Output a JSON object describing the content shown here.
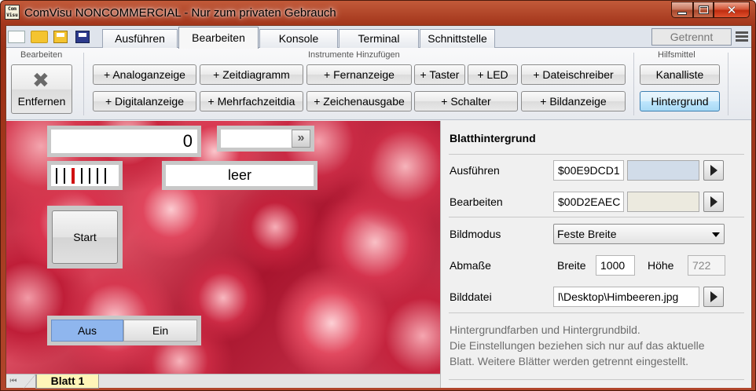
{
  "window": {
    "app_icon_text": "Com Visu",
    "title": "ComVisu NONCOMMERCIAL - Nur zum privaten Gebrauch"
  },
  "tabs": [
    "Ausführen",
    "Bearbeiten",
    "Konsole",
    "Terminal",
    "Schnittstelle"
  ],
  "active_tab": "Bearbeiten",
  "connection_status": "Getrennt",
  "ribbon": {
    "group_edit_label": "Bearbeiten",
    "remove_label": "Entfernen",
    "group_instruments_label": "Instrumente Hinzufügen",
    "instruments": {
      "analog": "+ Analoganzeige",
      "timechart": "+ Zeitdiagramm",
      "remote": "+ Fernanzeige",
      "pushbutton": "+ Taster",
      "led": "+ LED",
      "filewriter": "+ Dateischreiber",
      "digital": "+ Digitalanzeige",
      "multichart": "+ Mehrfachzeitdia",
      "charout": "+ Zeichenausgabe",
      "switch": "+ Schalter",
      "image": "+ Bildanzeige"
    },
    "group_tools_label": "Hilfsmittel",
    "channel_list_label": "Kanalliste",
    "background_label": "Hintergrund"
  },
  "canvas": {
    "numeric_value": "0",
    "text_display": "leer",
    "edit_arrow_glyph": "»",
    "start_label": "Start",
    "switch_off": "Aus",
    "switch_on": "Ein"
  },
  "sheet": {
    "nav_glyph": "⏮",
    "tab_label": "Blatt 1"
  },
  "properties": {
    "title": "Blatthintergrund",
    "run_label": "Ausführen",
    "run_color": "$00E9DCD1",
    "run_swatch": "#d1dce9",
    "edit_label": "Bearbeiten",
    "edit_color": "$00D2EAEC",
    "edit_swatch": "#eceadf",
    "image_mode_label": "Bildmodus",
    "image_mode_value": "Feste Breite",
    "dimensions_label": "Abmaße",
    "width_label": "Breite",
    "width_value": "1000",
    "height_label": "Höhe",
    "height_value": "722",
    "file_label": "Bilddatei",
    "file_value": "l\\Desktop\\Himbeeren.jpg",
    "help_line1": "Hintergrundfarben und Hintergrundbild.",
    "help_line2": "Die Einstellungen beziehen sich nur auf das aktuelle",
    "help_line3": "Blatt. Weitere Blätter werden getrennt eingestellt."
  },
  "colors": {
    "titlebar": "#a3361c",
    "active_button": "#bee6fd",
    "switch_active": "#8fb6ee",
    "sheet_tab": "#fff5b8"
  },
  "icons": [
    "app-icon",
    "new-file-icon",
    "open-folder-icon",
    "save-icon",
    "save-as-icon",
    "menu-icon",
    "remove-x-icon",
    "arrow-right-icon",
    "dropdown-chevron-icon",
    "first-sheet-icon"
  ]
}
